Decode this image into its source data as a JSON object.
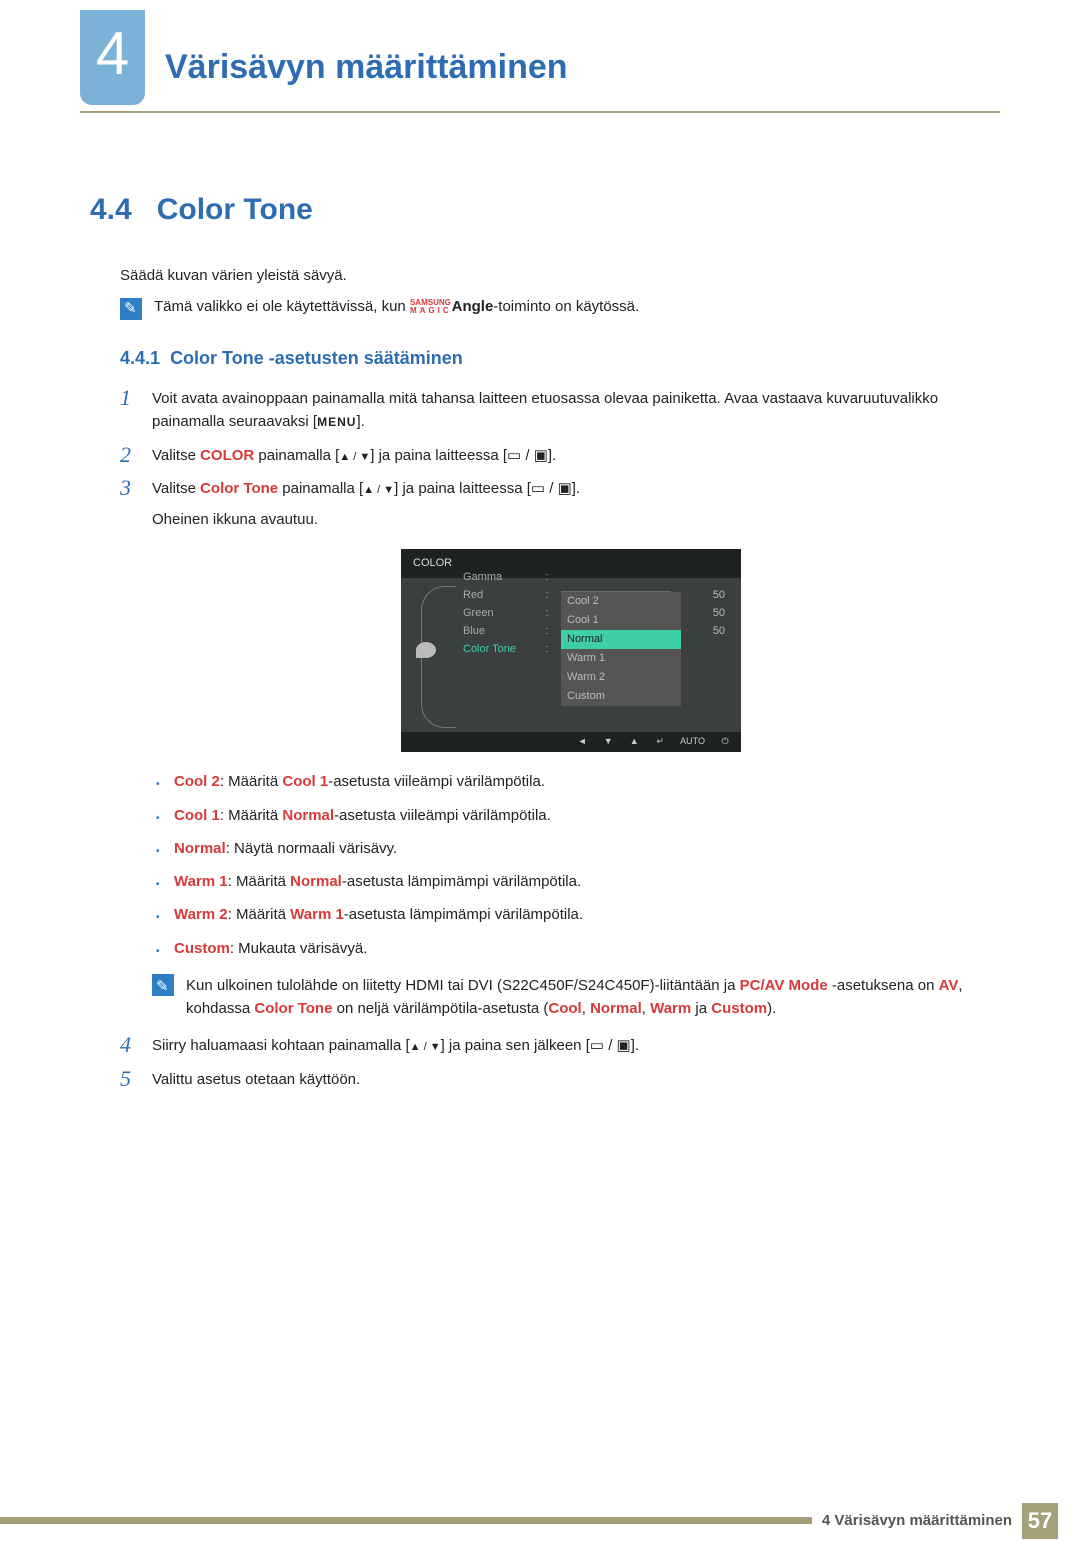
{
  "chapter": {
    "number": "4",
    "title": "Värisävyn määrittäminen"
  },
  "section": {
    "number": "4.4",
    "title": "Color Tone",
    "intro": "Säädä kuvan värien yleistä sävyä."
  },
  "note1": {
    "pre": "Tämä valikko ei ole käytettävissä, kun ",
    "brand_top": "SAMSUNG",
    "brand_bot": "MAGIC",
    "angle": "Angle",
    "post": "-toiminto on käytössä."
  },
  "subsection": {
    "number": "4.4.1",
    "title": "Color Tone -asetusten säätäminen"
  },
  "steps": {
    "s1": {
      "num": "1",
      "text_a": "Voit avata avainoppaan painamalla mitä tahansa laitteen etuosassa olevaa painiketta. Avaa vastaava kuvaruutuvalikko painamalla seuraavaksi [",
      "menu": "MENU",
      "text_b": "]."
    },
    "s2": {
      "num": "2",
      "a": "Valitse ",
      "kw": "COLOR",
      "b": " painamalla [",
      "tri": "▲ / ▼",
      "c": "] ja paina laitteessa [",
      "ic": "▭ / ▣",
      "d": "]."
    },
    "s3": {
      "num": "3",
      "a": "Valitse ",
      "kw": "Color Tone",
      "b": " painamalla [",
      "tri": "▲ / ▼",
      "c": "] ja paina laitteessa [",
      "ic": "▭ / ▣",
      "d": "].",
      "after": "Oheinen ikkuna avautuu."
    },
    "s4": {
      "num": "4",
      "a": "Siirry haluamaasi kohtaan painamalla [",
      "tri": "▲ / ▼",
      "b": "] ja paina sen jälkeen [",
      "ic": "▭ / ▣",
      "c": "]."
    },
    "s5": {
      "num": "5",
      "text": "Valittu asetus otetaan käyttöön."
    }
  },
  "osd": {
    "title": "COLOR",
    "rows": [
      {
        "label": "Red",
        "value": "50"
      },
      {
        "label": "Green",
        "value": "50"
      },
      {
        "label": "Blue",
        "value": "50"
      }
    ],
    "colortone_label": "Color Tone",
    "gamma_label": "Gamma",
    "options": [
      "Cool 2",
      "Cool 1",
      "Normal",
      "Warm 1",
      "Warm 2",
      "Custom"
    ],
    "selected_option": "Normal",
    "footer": [
      "◄",
      "▼",
      "▲",
      "↵",
      "AUTO",
      "⏻"
    ]
  },
  "option_list": [
    {
      "kw": "Cool 2",
      "a": ": Määritä ",
      "kw2": "Cool 1",
      "b": "-asetusta viileämpi värilämpötila."
    },
    {
      "kw": "Cool 1",
      "a": ": Määritä ",
      "kw2": "Normal",
      "b": "-asetusta viileämpi värilämpötila."
    },
    {
      "kw": "Normal",
      "a": ": Näytä normaali värisävy.",
      "kw2": "",
      "b": ""
    },
    {
      "kw": "Warm 1",
      "a": ": Määritä ",
      "kw2": "Normal",
      "b": "-asetusta lämpimämpi värilämpötila."
    },
    {
      "kw": "Warm 2",
      "a": ": Määritä ",
      "kw2": "Warm 1",
      "b": "-asetusta lämpimämpi värilämpötila."
    },
    {
      "kw": "Custom",
      "a": ": Mukauta värisävyä.",
      "kw2": "",
      "b": ""
    }
  ],
  "note2": {
    "a": "Kun ulkoinen tulolähde on liitetty HDMI tai DVI (S22C450F/S24C450F)-liitäntään ja ",
    "kw1": "PC/AV Mode",
    "b": " -asetuksena on ",
    "kw2": "AV",
    "c": ", kohdassa ",
    "kw3": "Color Tone",
    "d": " on neljä värilämpötila-asetusta (",
    "kw4": "Cool",
    "e": ", ",
    "kw5": "Normal",
    "f": ", ",
    "kw6": "Warm",
    "g": " ja ",
    "kw7": "Custom",
    "h": ")."
  },
  "footer": {
    "text": "4 Värisävyn määrittäminen",
    "page": "57"
  }
}
